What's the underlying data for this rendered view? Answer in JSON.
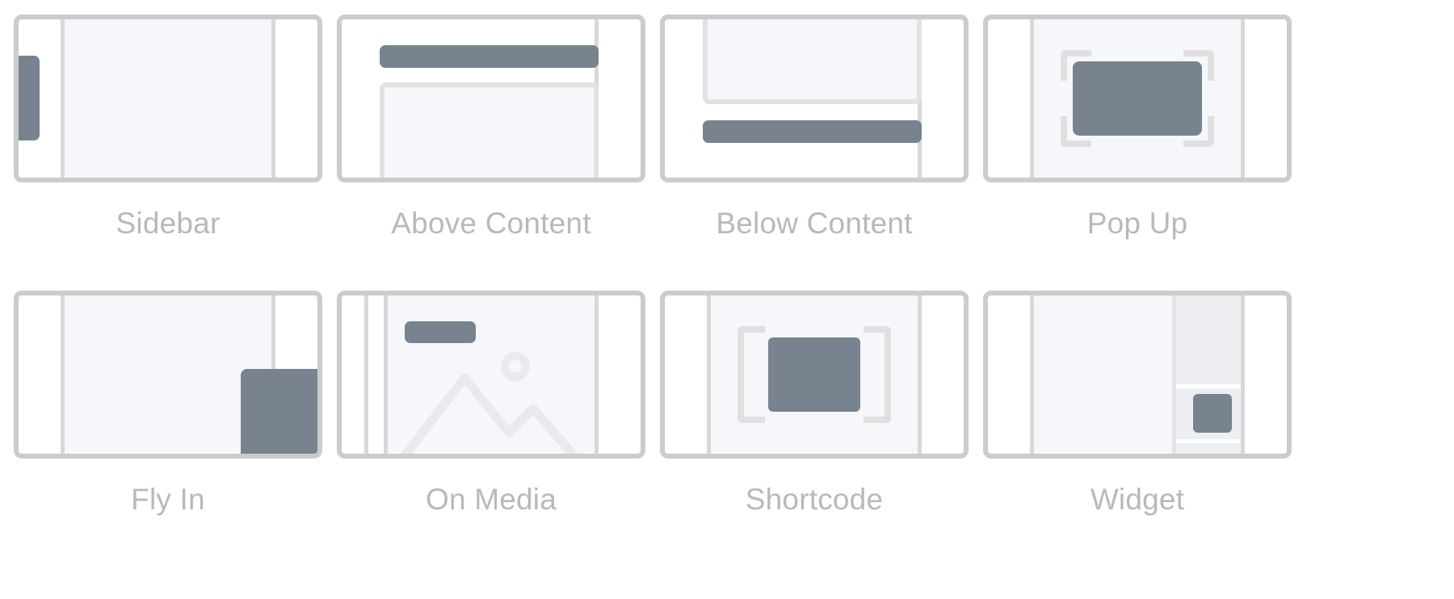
{
  "panel": {
    "name": "optin-display-type-chooser",
    "colors": {
      "card_border": "#cccccc",
      "content_fill": "#f5f7fa",
      "accent_dark": "#78838f",
      "divider": "#d8d8d8",
      "inner_outline": "#e2e2e2",
      "label_text": "#b7b9bb",
      "page_background": "#ffffff"
    },
    "rows": 2,
    "columns": 4
  },
  "options": [
    {
      "id": "sidebar",
      "label": "Sidebar",
      "icon": "sidebar-layout-icon"
    },
    {
      "id": "above-content",
      "label": "Above Content",
      "icon": "above-content-layout-icon"
    },
    {
      "id": "below-content",
      "label": "Below Content",
      "icon": "below-content-layout-icon"
    },
    {
      "id": "popup",
      "label": "Pop Up",
      "icon": "popup-layout-icon"
    },
    {
      "id": "fly-in",
      "label": "Fly In",
      "icon": "fly-in-layout-icon"
    },
    {
      "id": "on-media",
      "label": "On Media",
      "icon": "on-media-layout-icon"
    },
    {
      "id": "shortcode",
      "label": "Shortcode",
      "icon": "shortcode-layout-icon"
    },
    {
      "id": "widget",
      "label": "Widget",
      "icon": "widget-layout-icon"
    }
  ]
}
